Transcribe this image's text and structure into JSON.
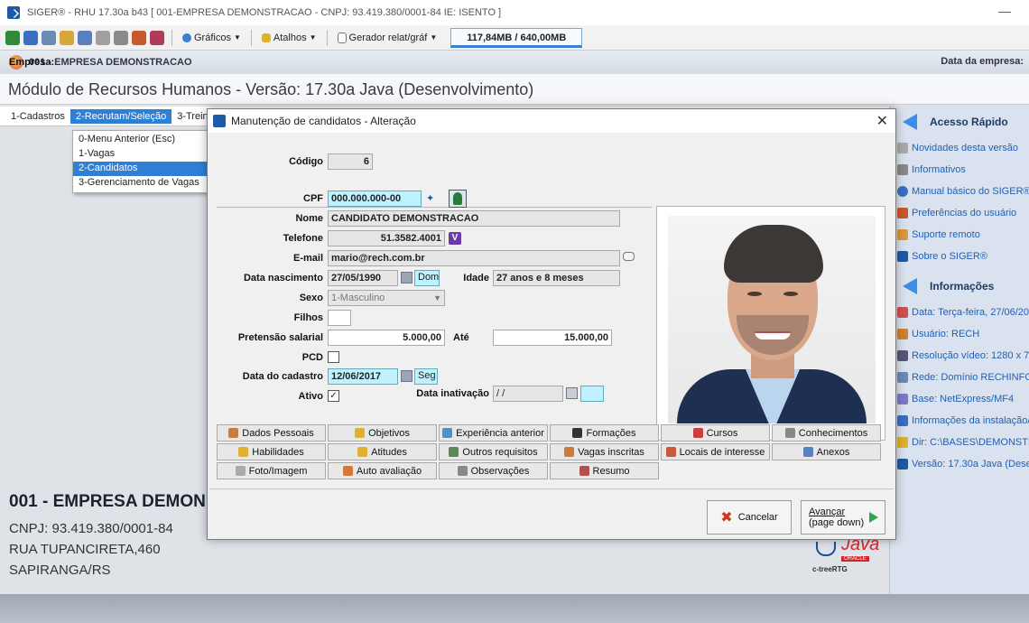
{
  "window": {
    "title": "SIGER® - RHU 17.30a b43 [ 001-EMPRESA DEMONSTRACAO - CNPJ: 93.419.380/0001-84 IE: ISENTO ]",
    "minimize": "—"
  },
  "toolbar": {
    "graficos": "Gráficos",
    "atalhos": "Atalhos",
    "gerador": "Gerador relat/gráf",
    "memory": "117,84MB / 640,00MB"
  },
  "empresa_bar": {
    "label": "Empresa:",
    "value": "001 - EMPRESA DEMONSTRACAO",
    "right": "Data da empresa:"
  },
  "modulo": "Módulo de Recursos Humanos - Versão: 17.30a Java (Desenvolvimento)",
  "menubar": [
    "1-Cadastros",
    "2-Recrutam/Seleção",
    "3-Trein"
  ],
  "dropdown": [
    "0-Menu Anterior (Esc)",
    "1-Vagas",
    "2-Candidatos",
    "3-Gerenciamento de Vagas"
  ],
  "company": {
    "name": "001 - EMPRESA DEMON",
    "cnpj": "CNPJ: 93.419.380/0001-84",
    "address": "RUA TUPANCIRETA,460",
    "city": "SAPIRANGA/RS"
  },
  "java_logo": {
    "java": "Java",
    "oracle": "ORACLE",
    "ctree": "c-treeRTG"
  },
  "side_panel": {
    "acesso_title": "Acesso Rápido",
    "acesso_items": [
      "Novidades desta versão",
      "Informativos",
      "Manual básico do SIGER®",
      "Preferências do usuário",
      "Suporte remoto",
      "Sobre o SIGER®"
    ],
    "info_title": "Informações",
    "info_items": [
      "Data: Terça-feira, 27/06/20",
      "Usuário: RECH",
      "Resolução vídeo: 1280 x 72",
      "Rede: Domínio RECHINFO (",
      "Base: NetExpress/MF4",
      "Informações da instalação/a",
      "Dir: C:\\BASES\\DEMONSTRA",
      "Versão: 17.30a Java (Deser"
    ]
  },
  "dialog": {
    "title": "Manutenção de candidatos - Alteração",
    "close": "✕",
    "labels": {
      "codigo": "Código",
      "cpf": "CPF",
      "nome": "Nome",
      "telefone": "Telefone",
      "email": "E-mail",
      "data_nascimento": "Data nascimento",
      "idade": "Idade",
      "sexo": "Sexo",
      "filhos": "Filhos",
      "pretensao": "Pretensão salarial",
      "ate": "Até",
      "pcd": "PCD",
      "data_cadastro": "Data do cadastro",
      "ativo": "Ativo",
      "data_inativacao": "Data inativação"
    },
    "values": {
      "codigo": "6",
      "cpf": "000.000.000-00",
      "nome": "CANDIDATO DEMONSTRACAO",
      "telefone": "51.3582.4001",
      "email": "mario@rech.com.br",
      "data_nascimento": "27/05/1990",
      "dia_nascimento": "Dom",
      "idade": "27 anos e 8 meses",
      "sexo": "1-Masculino",
      "filhos": "",
      "pretensao_de": "5.000,00",
      "pretensao_ate": "15.000,00",
      "pcd": "",
      "data_cadastro": "12/06/2017",
      "dia_cadastro": "Seg",
      "ativo": "✓",
      "data_inativacao": " / /"
    },
    "tab_buttons": [
      [
        "Dados Pessoais",
        "Objetivos",
        "Experiência anterior",
        "Formações",
        "Cursos",
        "Conhecimentos"
      ],
      [
        "Habilidades",
        "Atitudes",
        "Outros requisitos",
        "Vagas inscritas",
        "Locais de interesse",
        "Anexos"
      ],
      [
        "Foto/Imagem",
        "Auto avaliação",
        "Observações",
        "Resumo"
      ]
    ],
    "cancel": "Cancelar",
    "next_line1": "Avançar",
    "next_line2": "(page down)"
  },
  "colors": {
    "accent": "#2f7fd4",
    "focus_field": "#bff2ff",
    "side_link": "#2160b6"
  }
}
